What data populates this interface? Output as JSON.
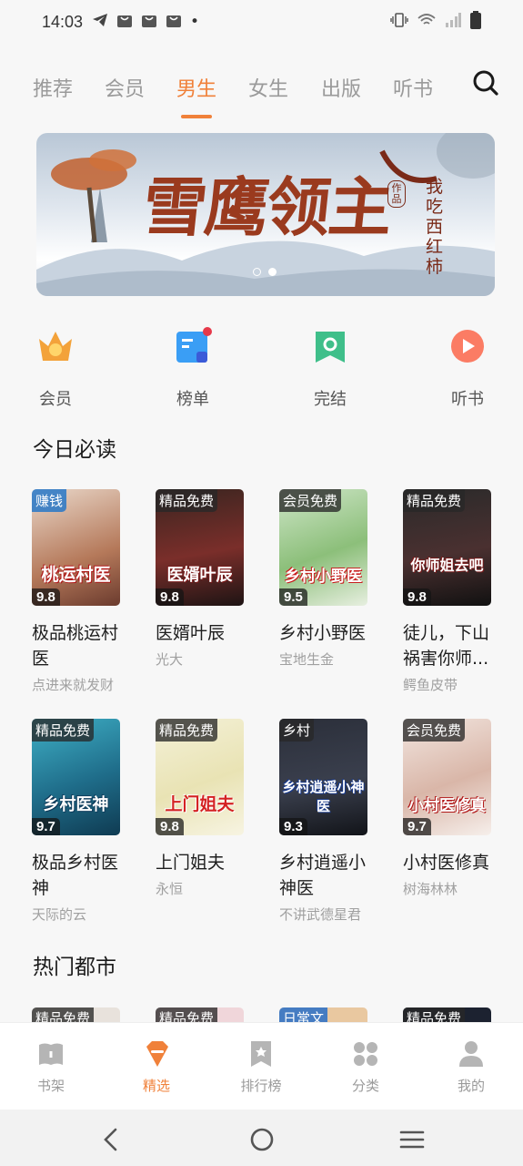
{
  "status_bar": {
    "time": "14:03",
    "dot": "•"
  },
  "top_tabs": [
    {
      "label": "推荐",
      "active": false
    },
    {
      "label": "会员",
      "active": false
    },
    {
      "label": "男生",
      "active": true
    },
    {
      "label": "女生",
      "active": false
    },
    {
      "label": "出版",
      "active": false
    },
    {
      "label": "听书",
      "active": false
    }
  ],
  "banner": {
    "title": "雪鹰领主",
    "author": "我吃西红柿",
    "seal": "作品",
    "slides": 2,
    "active_slide": 2
  },
  "quick_entries": [
    {
      "label": "会员",
      "icon": "crown-icon"
    },
    {
      "label": "榜单",
      "icon": "ranking-list-icon"
    },
    {
      "label": "完结",
      "icon": "bookmark-complete-icon"
    },
    {
      "label": "听书",
      "icon": "play-audio-icon"
    }
  ],
  "sections": {
    "today_must_read": "今日必读",
    "hot_city": "热门都市"
  },
  "books": [
    {
      "tag": "赚钱",
      "score": "9.8",
      "cover_text": "桃运村医",
      "name": "极品桃运村医",
      "author": "点进来就发财"
    },
    {
      "tag": "精品免费",
      "score": "9.8",
      "cover_text": "医婿叶辰",
      "name": "医婿叶辰",
      "author": "光大"
    },
    {
      "tag": "会员免费",
      "score": "9.5",
      "cover_text": "乡村小野医",
      "name": "乡村小野医",
      "author": "宝地生金"
    },
    {
      "tag": "精品免费",
      "score": "9.8",
      "cover_text": "你师姐去吧",
      "name": "徒儿，下山祸害你师...",
      "author": "鳄鱼皮带"
    },
    {
      "tag": "精品免费",
      "score": "9.7",
      "cover_text": "乡村医神",
      "name": "极品乡村医神",
      "author": "天际的云"
    },
    {
      "tag": "精品免费",
      "score": "9.8",
      "cover_text": "上门姐夫",
      "name": "上门姐夫",
      "author": "永恒"
    },
    {
      "tag": "乡村",
      "score": "9.3",
      "cover_text": "乡村逍遥小神医",
      "name": "乡村逍遥小神医",
      "author": "不讲武德星君"
    },
    {
      "tag": "会员免费",
      "score": "9.7",
      "cover_text": "小村医修真",
      "name": "小村医修真",
      "author": "树海林林"
    }
  ],
  "peek_tags": [
    "精品免费",
    "精品免费",
    "日常文",
    "精品免费"
  ],
  "bottom_nav": [
    {
      "label": "书架",
      "icon": "bookshelf-icon",
      "active": false
    },
    {
      "label": "精选",
      "icon": "featured-icon",
      "active": true
    },
    {
      "label": "排行榜",
      "icon": "ranking-icon",
      "active": false
    },
    {
      "label": "分类",
      "icon": "category-icon",
      "active": false
    },
    {
      "label": "我的",
      "icon": "profile-icon",
      "active": false
    }
  ],
  "colors": {
    "accent": "#f0813a",
    "inactive": "#9a9a9a"
  }
}
